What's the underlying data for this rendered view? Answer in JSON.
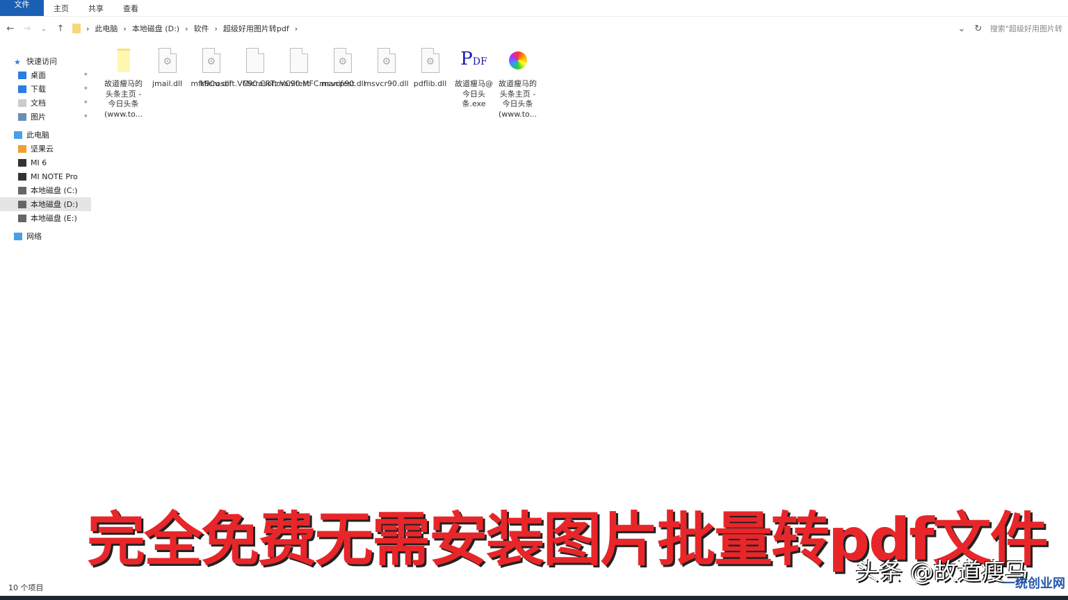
{
  "ribbon": {
    "tabs": [
      "文件",
      "主页",
      "共享",
      "查看"
    ]
  },
  "address": {
    "crumbs": [
      "此电脑",
      "本地磁盘 (D:)",
      "软件",
      "超级好用图片转pdf"
    ],
    "search_placeholder": "搜索\"超级好用图片转pdf\""
  },
  "sidebar": {
    "items": [
      {
        "label": "快速访问",
        "icon": "star-icon",
        "top": true
      },
      {
        "label": "桌面",
        "icon": "desktop-icon",
        "pin": true
      },
      {
        "label": "下载",
        "icon": "download-icon",
        "pin": true
      },
      {
        "label": "文档",
        "icon": "document-icon",
        "pin": true
      },
      {
        "label": "图片",
        "icon": "picture-icon",
        "pin": true
      },
      {
        "label": "此电脑",
        "icon": "computer-icon",
        "top": true
      },
      {
        "label": "坚果云",
        "icon": "nutstore-icon"
      },
      {
        "label": "MI 6",
        "icon": "phone-icon"
      },
      {
        "label": "MI NOTE Pro",
        "icon": "phone-icon"
      },
      {
        "label": "本地磁盘 (C:)",
        "icon": "drive-icon"
      },
      {
        "label": "本地磁盘 (D:)",
        "icon": "drive-icon",
        "selected": true
      },
      {
        "label": "本地磁盘 (E:)",
        "icon": "drive-icon"
      },
      {
        "label": "网络",
        "icon": "network-icon",
        "top": true
      }
    ]
  },
  "files": [
    {
      "name": "故道瘦马的头条主页 - 今日头条 (www.to...",
      "icon": "shortcut-icon"
    },
    {
      "name": "jmail.dll",
      "icon": "dll-icon"
    },
    {
      "name": "mfc90u.dll",
      "icon": "dll-icon"
    },
    {
      "name": "Microsoft.VC90.CRT.manifest",
      "icon": "file-icon"
    },
    {
      "name": "Microsoft.VC90.MFC.manifest",
      "icon": "file-icon"
    },
    {
      "name": "msvcp90.dll",
      "icon": "dll-icon"
    },
    {
      "name": "msvcr90.dll",
      "icon": "dll-icon"
    },
    {
      "name": "pdflib.dll",
      "icon": "dll-icon"
    },
    {
      "name": "故道瘦马@今日头条.exe",
      "icon": "pdf-app-icon"
    },
    {
      "name": "故道瘦马的头条主页 - 今日头条 (www.to...",
      "icon": "browser-icon"
    }
  ],
  "status": "10 个项目",
  "overlay": {
    "banner": "完全免费无需安装图片批量转pdf文件",
    "watermark": "头条 @故道瘦马",
    "site_watermark": "一统创业网"
  }
}
